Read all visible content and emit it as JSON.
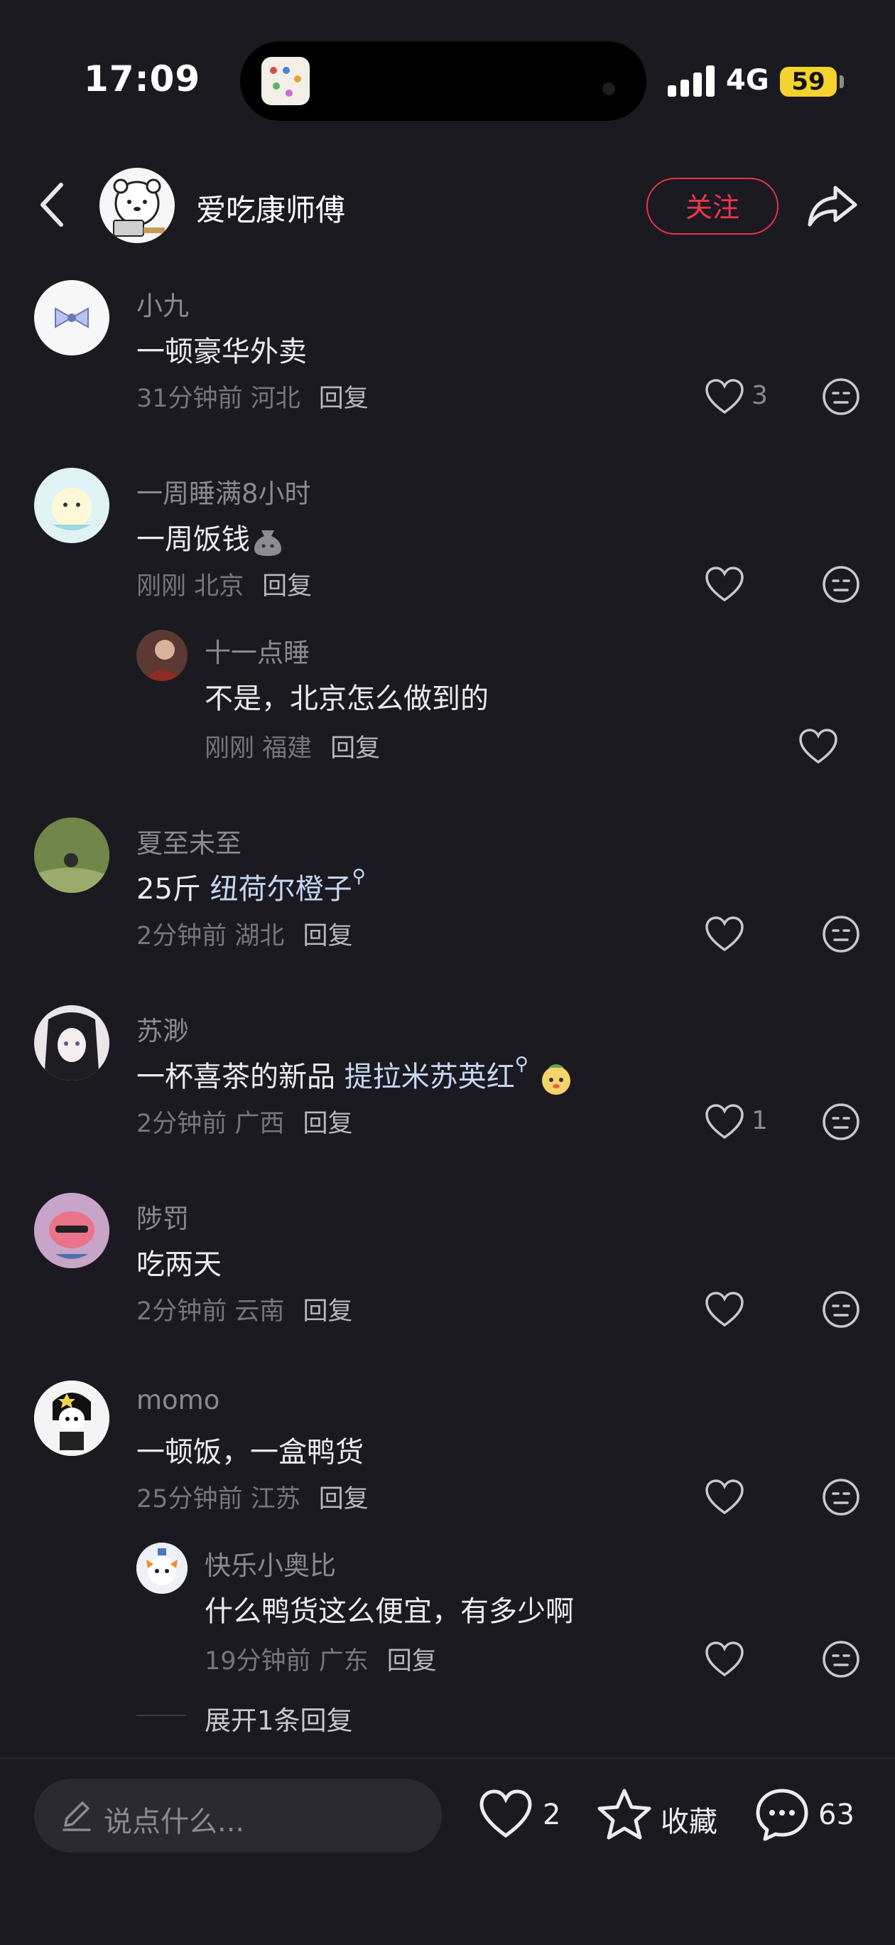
{
  "status_bar": {
    "time": "17:09",
    "network": "4G",
    "battery": "59"
  },
  "header": {
    "username": "爱吃康师傅",
    "follow_label": "关注"
  },
  "comments": [
    {
      "name": "小九",
      "text": "一顿豪华外卖",
      "time": "31分钟前",
      "location": "河北",
      "reply": "回复",
      "likes": "3"
    },
    {
      "name": "一周睡满8小时",
      "text": "一周饭钱",
      "time": "刚刚",
      "location": "北京",
      "reply": "回复",
      "likes": ""
    },
    {
      "name": "十一点睡",
      "text": "不是，北京怎么做到的",
      "time": "刚刚",
      "location": "福建",
      "reply": "回复",
      "likes": ""
    },
    {
      "name": "夏至未至",
      "text": "25斤 ",
      "link": "纽荷尔橙子",
      "time": "2分钟前",
      "location": "湖北",
      "reply": "回复",
      "likes": ""
    },
    {
      "name": "苏渺",
      "text": "一杯喜茶的新品 ",
      "link": "提拉米苏英红",
      "time": "2分钟前",
      "location": "广西",
      "reply": "回复",
      "likes": "1"
    },
    {
      "name": "陟罚",
      "text": "吃两天",
      "time": "2分钟前",
      "location": "云南",
      "reply": "回复",
      "likes": ""
    },
    {
      "name": "momo",
      "text": "一顿饭，一盒鸭货",
      "time": "25分钟前",
      "location": "江苏",
      "reply": "回复",
      "likes": ""
    },
    {
      "name": "快乐小奥比",
      "text": "什么鸭货这么便宜，有多少啊",
      "time": "19分钟前",
      "location": "广东",
      "reply": "回复",
      "likes": ""
    }
  ],
  "expand_replies": "展开1条回复",
  "bottom_bar": {
    "input_placeholder": "说点什么...",
    "like_count": "2",
    "favorite_label": "收藏",
    "comment_count": "63"
  },
  "colors": {
    "background": "#1b1a20",
    "follow_red": "#e8334a",
    "battery_yellow": "#f4d22f",
    "link_blue": "#c6d6f2"
  }
}
